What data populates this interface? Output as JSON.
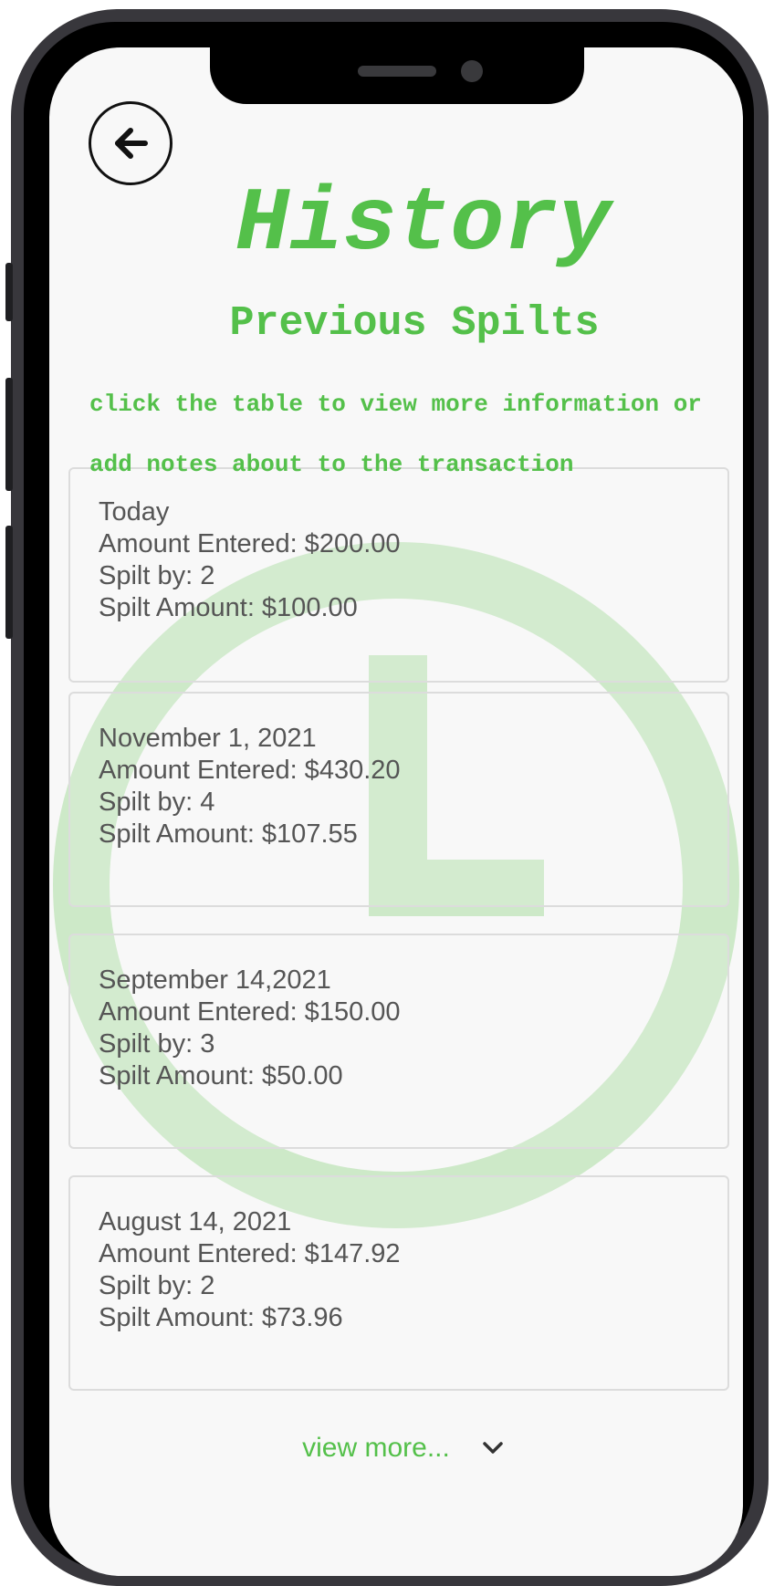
{
  "header": {
    "back_icon": "arrow-left-icon",
    "title": "History",
    "subtitle": "Previous Spilts",
    "instructions": "click the table to view more information or add notes about to the transaction"
  },
  "transactions": [
    {
      "date": "Today",
      "amount_entered": "Amount Entered: $200.00",
      "split_by": "Spilt by: 2",
      "split_amount": "Spilt Amount: $100.00"
    },
    {
      "date": "November 1, 2021",
      "amount_entered": "Amount Entered: $430.20",
      "split_by": "Spilt by: 4",
      "split_amount": "Spilt Amount: $107.55"
    },
    {
      "date": "September 14,2021",
      "amount_entered": "Amount Entered: $150.00",
      "split_by": "Spilt by: 3",
      "split_amount": "Spilt Amount: $50.00"
    },
    {
      "date": "August 14, 2021",
      "amount_entered": "Amount Entered: $147.92",
      "split_by": "Spilt by: 2",
      "split_amount": "Spilt Amount: $73.96"
    }
  ],
  "footer": {
    "view_more_label": "view more...",
    "chevron_icon": "chevron-down-icon"
  },
  "colors": {
    "accent_green": "#54c04a",
    "watermark_green": "#cde9c8",
    "text_gray": "#555555",
    "screen_bg": "#f8f8f8"
  }
}
